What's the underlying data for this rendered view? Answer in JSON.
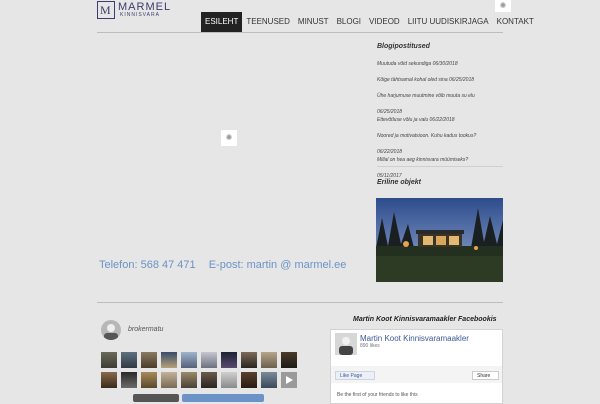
{
  "header": {
    "logo_name": "MARMEL",
    "logo_sub": "KINNISVARA",
    "logo_mark": "M",
    "nav": [
      {
        "label": "ESILEHT",
        "active": true
      },
      {
        "label": "TEENUSED"
      },
      {
        "label": "MINUST"
      },
      {
        "label": "BLOGI"
      },
      {
        "label": "VIDEOD"
      },
      {
        "label": "LIITU UUDISKIRJAGA"
      },
      {
        "label": "KONTAKT"
      }
    ]
  },
  "contact": {
    "phone": "Telefon: 568 47 471",
    "email": "E-post: martin @ marmel.ee"
  },
  "blog": {
    "title": "Blogipostitused",
    "entries": [
      "Muutuda võid sekundiga 06/30/2018",
      "Kõige tähtsamal kohal oled sina 06/25/2018",
      "Ühe harjumuse muutmine võib muuta su elu",
      "06/25/2018",
      "Ettevõtluse võlu ja valu 06/22/2018",
      "Noored ja motivatsioon. Kuhu kadus tookus?",
      "06/22/2018",
      "Millal on hea aeg kinnisvara müümiseks?",
      "05/11/2017"
    ]
  },
  "featured": {
    "title": "Eriline objekt"
  },
  "instagram": {
    "username": "brokermatu"
  },
  "facebook": {
    "heading": "Martin Koot Kinnisvaramaakler Facebookis",
    "page_name": "Martin Koot Kinnisvaramaakler",
    "likes": "890 likes",
    "like_btn": "Like Page",
    "share_btn": "Share",
    "friends_text": "Be the first of your friends to like this"
  },
  "colors": {
    "accent": "#6b93c7",
    "nav_active": "#222222"
  }
}
